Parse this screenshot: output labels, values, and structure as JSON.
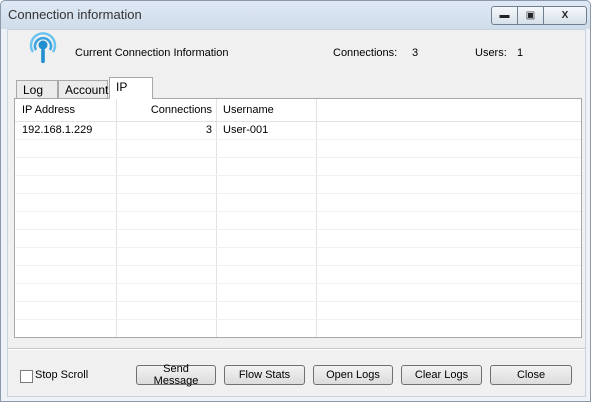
{
  "window": {
    "title": "Connection information"
  },
  "titlebar_buttons": {
    "minimize": "▭",
    "maximize": "◻",
    "close": "X"
  },
  "header": {
    "title": "Current Connection Information",
    "connections_label": "Connections:",
    "connections_value": "3",
    "users_label": "Users:",
    "users_value": "1"
  },
  "tabs": [
    {
      "label": "Log"
    },
    {
      "label": "Account"
    },
    {
      "label": "IP",
      "selected": true
    }
  ],
  "table": {
    "columns": [
      "IP Address",
      "Connections",
      "Username"
    ],
    "rows": [
      {
        "ip": "192.168.1.229",
        "connections": "3",
        "username": "User-001"
      }
    ]
  },
  "footer": {
    "stop_scroll_label": "Stop Scroll",
    "stop_scroll_checked": false,
    "buttons": {
      "send_message": "Send Message",
      "flow_stats": "Flow Stats",
      "open_logs": "Open Logs",
      "clear_logs": "Clear Logs",
      "close": "Close"
    }
  },
  "icons": {
    "header_icon": "wireless-signal-icon",
    "accent": "#1f8fd0"
  }
}
